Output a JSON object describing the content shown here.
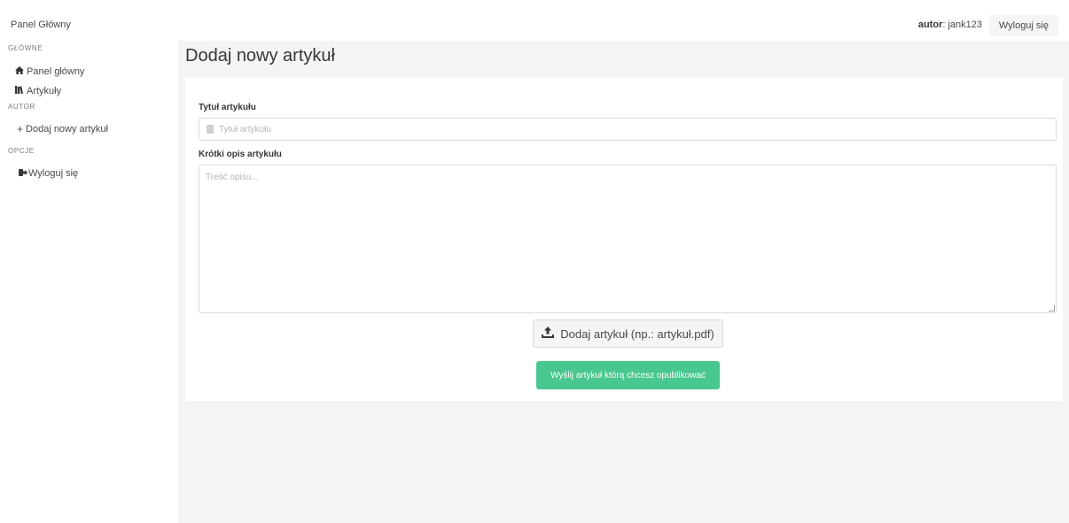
{
  "header": {
    "brand": "Panel Główny",
    "author_label": "autor",
    "author_sep": ":",
    "author_name": " jank123",
    "logout_label": "Wyloguj się"
  },
  "sidebar": {
    "section_main": "GŁÓWNE",
    "items_main": [
      {
        "label": "Panel główny",
        "icon": "home-icon"
      },
      {
        "label": "Artykuły",
        "icon": "books-icon"
      }
    ],
    "section_author": "AUTOR",
    "items_author": [
      {
        "label": "Dodaj nowy artykuł",
        "icon": "plus-icon"
      }
    ],
    "section_options": "OPCJE",
    "items_options": [
      {
        "label": "Wyloguj się",
        "icon": "sign-out-icon"
      }
    ]
  },
  "main": {
    "page_title": "Dodaj nowy artykuł",
    "form": {
      "title_label": "Tytuł artykułu",
      "title_placeholder": "Tytuł artykułu",
      "title_value": "",
      "desc_label": "Krótki opis artykułu",
      "desc_placeholder": "Treść opisu...",
      "desc_value": "",
      "upload_label": "Dodaj artykuł (np.: artykuł.pdf)",
      "submit_label": "Wyślij artykuł którą chcesz opublikować"
    }
  },
  "colors": {
    "accent_green": "#48c78e",
    "main_bg": "#f4f4f4",
    "border": "#dbdbdb"
  }
}
